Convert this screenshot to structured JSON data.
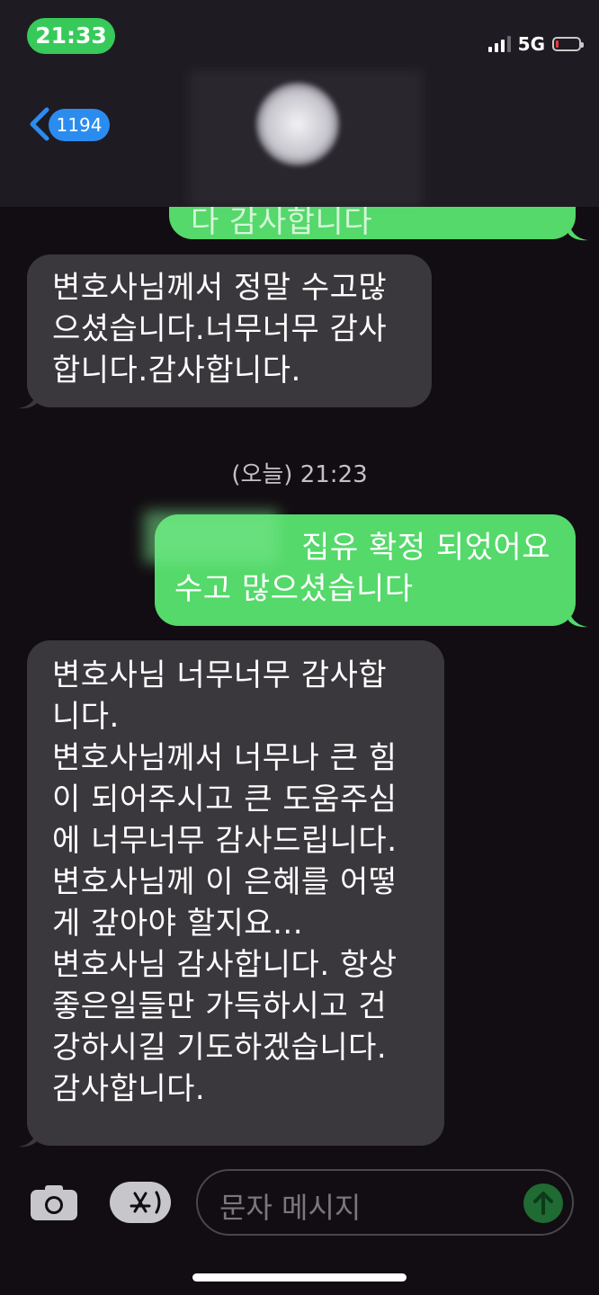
{
  "status_bar": {
    "time": "21:33",
    "network": "5G",
    "battery_level": 0.1
  },
  "header": {
    "back_count": "1194"
  },
  "messages": {
    "outgoing_top_partial": "다 감사합니다",
    "incoming_1": [
      "변호사님께서 정말 수고많",
      "으셨습니다.너무너무 감사",
      "합니다.감사합니다."
    ],
    "timestamp": "(오늘) 21:23",
    "outgoing_2": [
      "집유 확정 되었어요",
      "수고 많으셨습니다"
    ],
    "incoming_2": [
      "변호사님 너무너무 감사합",
      "니다.",
      "변호사님께서 너무나 큰 힘",
      "이 되어주시고 큰 도움주심",
      "에 너무너무 감사드립니다.",
      "변호사님께 이 은혜를 어떻",
      "게 갚아야 할지요...",
      "변호사님 감사합니다. 항상",
      "좋은일들만 가득하시고 건",
      "강하시길 기도하겠습니다.",
      "감사합니다."
    ]
  },
  "input": {
    "placeholder": "문자 메시지"
  },
  "icons": {
    "back": "chevron-left-icon",
    "camera": "camera-icon",
    "appstore": "app-store-icon",
    "send": "arrow-up-icon"
  },
  "colors": {
    "incoming_bubble": "#3a373d",
    "outgoing_bubble": "#54d96a",
    "badge": "#2b8cf0",
    "time_pill": "#37c95a"
  }
}
